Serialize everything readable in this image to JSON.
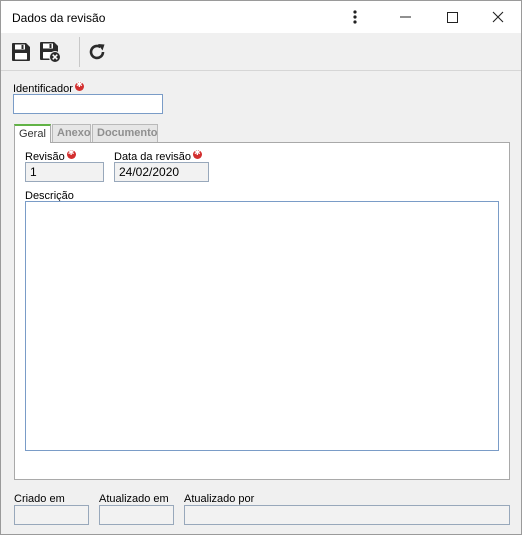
{
  "window": {
    "title": "Dados da revisão"
  },
  "titlebar_icons": [
    "more-vertical-icon",
    "minimize-icon",
    "maximize-icon",
    "close-icon"
  ],
  "toolbar": {
    "icons": [
      "save-icon",
      "save-and-close-icon",
      "refresh-icon"
    ]
  },
  "form": {
    "identifier_label": "Identificador",
    "identifier_value": "",
    "tabs": [
      {
        "label": "Geral",
        "active": true
      },
      {
        "label": "Anexo",
        "active": false
      },
      {
        "label": "Documento",
        "active": false
      }
    ],
    "revision_label": "Revisão",
    "revision_value": "1",
    "revision_date_label": "Data da revisão",
    "revision_date_value": "24/02/2020",
    "description_label": "Descrição",
    "description_value": ""
  },
  "footer": {
    "created_label": "Criado em",
    "created_value": "",
    "updated_label": "Atualizado em",
    "updated_value": "",
    "updated_by_label": "Atualizado por",
    "updated_by_value": ""
  },
  "colors": {
    "required_marker": "#d32f2f",
    "active_tab_accent": "#62b346",
    "input_border": "#7a9cc7"
  }
}
